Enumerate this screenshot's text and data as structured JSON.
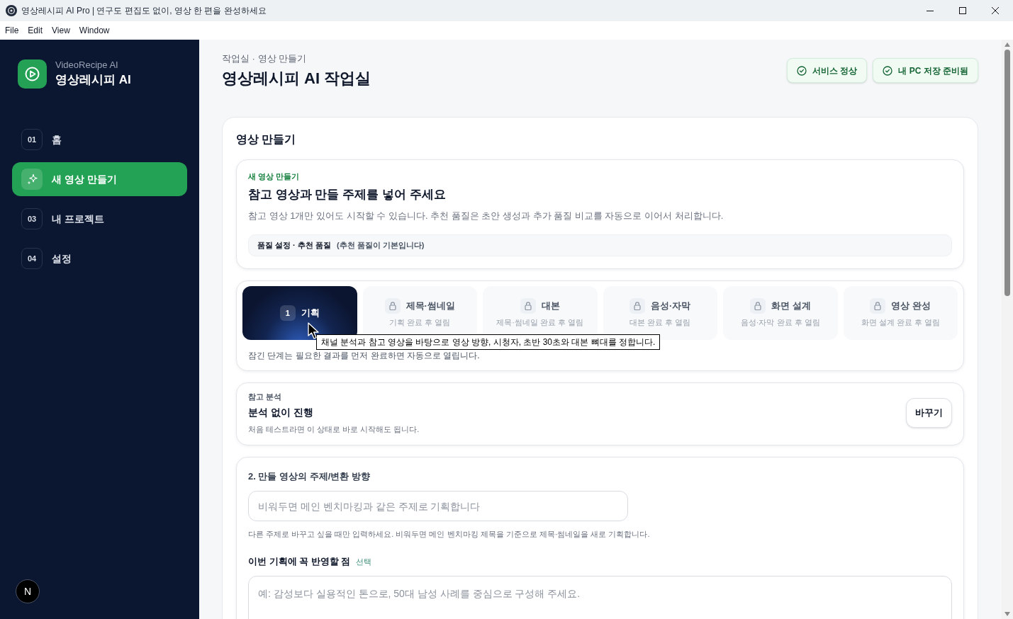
{
  "window": {
    "title": "영상레시피 AI Pro | 연구도 편집도 없이, 영상 한 편을 완성하세요"
  },
  "menu_bar": [
    "File",
    "Edit",
    "View",
    "Window"
  ],
  "sidebar": {
    "brand": {
      "subtitle": "VideoRecipe AI",
      "name": "영상레시피 AI"
    },
    "items": [
      {
        "number": "01",
        "label": "홈",
        "selected": false
      },
      {
        "label": "새 영상 만들기",
        "selected": true
      },
      {
        "number": "03",
        "label": "내 프로젝트",
        "selected": false
      },
      {
        "number": "04",
        "label": "설정",
        "selected": false
      }
    ],
    "user": {
      "initial": "N"
    }
  },
  "header": {
    "breadcrumb": "작업실 · 영상 만들기",
    "title": "영상레시피 AI 작업실",
    "status_badges": [
      "서비스 정상",
      "내 PC 저장 준비됨"
    ]
  },
  "panel": {
    "title": "영상 만들기",
    "intro": {
      "eyebrow": "새 영상 만들기",
      "heading": "참고 영상과 만들 주제를 넣어 주세요",
      "description": "참고 영상 1개만 있어도 시작할 수 있습니다. 추천 품질은 초안 생성과 추가 품질 비교를 자동으로 이어서 처리합니다.",
      "quality": {
        "label": "품질 설정 · 추천 품질",
        "note": "(추천 품질이 기본입니다)"
      }
    },
    "steps": [
      {
        "number": "1",
        "title": "기획",
        "selected": true,
        "locked": false
      },
      {
        "title": "제목·썸네일",
        "hint": "기획 완료 후 열림",
        "selected": false,
        "locked": true
      },
      {
        "title": "대본",
        "hint": "제목·썸네일 완료 후 열림",
        "selected": false,
        "locked": true
      },
      {
        "title": "음성·자막",
        "hint": "대본 완료 후 열림",
        "selected": false,
        "locked": true
      },
      {
        "title": "화면 설계",
        "hint": "음성·자막 완료 후 열림",
        "selected": false,
        "locked": true
      },
      {
        "title": "영상 완성",
        "hint": "화면 설계 완료 후 열림",
        "selected": false,
        "locked": true
      }
    ],
    "steps_note": "잠긴 단계는 필요한 결과를 먼저 완료하면 자동으로 열립니다.",
    "tooltip": "채널 분석과 참고 영상을 바탕으로 영상 방향, 시청자, 초반 30초와 대본 뼈대를 정합니다.",
    "reference": {
      "label": "참고 분석",
      "value": "분석 없이 진행",
      "hint": "처음 테스트라면 이 상태로 바로 시작해도 됩니다.",
      "button": "바꾸기"
    },
    "topic": {
      "label": "2. 만들 영상의 주제/변환 방향",
      "placeholder": "비워두면 메인 벤치마킹과 같은 주제로 기획합니다",
      "help": "다른 주제로 바꾸고 싶을 때만 입력하세요. 비워두면 메인 벤치마킹 제목을 기준으로 제목·썸네일을 새로 기획합니다."
    },
    "must_include": {
      "label": "이번 기획에 꼭 반영할 점",
      "optional": "선택",
      "placeholder": "예: 감성보다 실용적인 톤으로, 50대 남성 사례를 중심으로 구성해 주세요."
    }
  }
}
